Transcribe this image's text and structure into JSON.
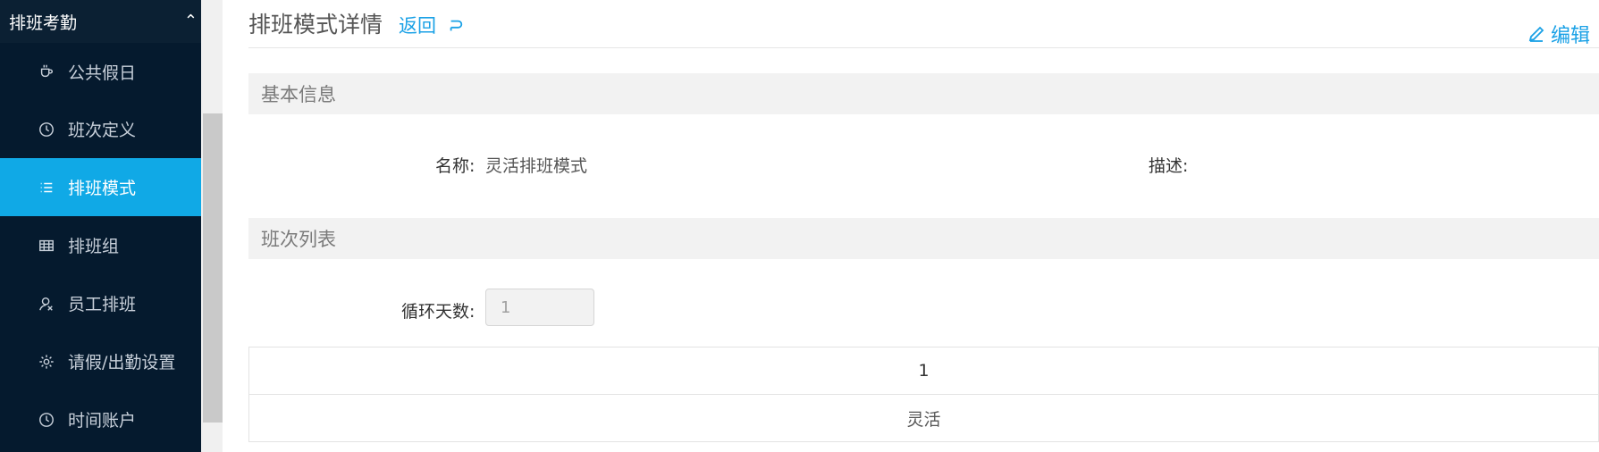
{
  "sidebar": {
    "group_label": "排班考勤",
    "items": [
      {
        "label": "公共假日",
        "icon": "coffee-icon",
        "active": false
      },
      {
        "label": "班次定义",
        "icon": "clock-icon",
        "active": false
      },
      {
        "label": "排班模式",
        "icon": "list-icon",
        "active": true
      },
      {
        "label": "排班组",
        "icon": "table-icon",
        "active": false
      },
      {
        "label": "员工排班",
        "icon": "user-icon",
        "active": false
      },
      {
        "label": "请假/出勤设置",
        "icon": "gear-icon",
        "active": false
      },
      {
        "label": "时间账户",
        "icon": "clock-icon",
        "active": false
      }
    ]
  },
  "header": {
    "title": "排班模式详情",
    "back_label": "返回",
    "edit_label": "编辑"
  },
  "basic_info": {
    "section_title": "基本信息",
    "name_label": "名称:",
    "name_value": "灵活排班模式",
    "desc_label": "描述:",
    "desc_value": ""
  },
  "shift_list": {
    "section_title": "班次列表",
    "cycle_label": "循环天数:",
    "cycle_value": "1",
    "table_header": [
      "1"
    ],
    "table_row": [
      "灵活"
    ]
  },
  "colors": {
    "accent": "#10a9e6",
    "sidebar_bg": "#051a2e",
    "link": "#1aa1e6"
  }
}
